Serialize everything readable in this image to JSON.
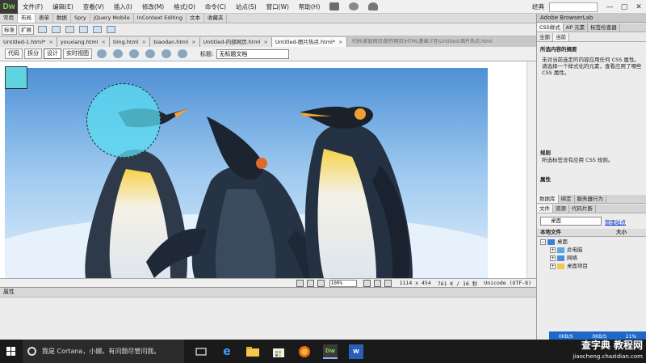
{
  "app": {
    "logo": "Dw",
    "menu": [
      "文件(F)",
      "编辑(E)",
      "查看(V)",
      "插入(I)",
      "修改(M)",
      "格式(O)",
      "命令(C)",
      "站点(S)",
      "窗口(W)",
      "帮助(H)"
    ],
    "workspace": "经典"
  },
  "insert_tabs": [
    "常用",
    "布局",
    "表单",
    "数据",
    "Spry",
    "jQuery Mobile",
    "InContext Editing",
    "文本",
    "收藏夹"
  ],
  "insert_tabs_active": 1,
  "insert_bar": {
    "standard": "标准",
    "expanded": "扩展"
  },
  "doc_tabs": [
    {
      "label": "Untitled-1.html*"
    },
    {
      "label": "youxiang.html"
    },
    {
      "label": "timg.html"
    },
    {
      "label": "biaodan.html"
    },
    {
      "label": "Untitled-内部网页.html"
    },
    {
      "label": "Untitled-图片热点.html*"
    }
  ],
  "doc_tabs_active": 5,
  "doc_path": "代码\\家庭网页\\制作网页\\HTML基础\\7月\\Untitled-图片热点.html",
  "doc_toolbar": {
    "views": [
      "代码",
      "拆分",
      "设计",
      "实时视图"
    ],
    "active_view": 2,
    "title_label": "标题:",
    "title_value": "无标题文档"
  },
  "status_bar": {
    "zoom": "100%",
    "dimensions": "1114 x 454",
    "size": "761 K / 16 秒",
    "encoding": "Unicode (UTF-8)"
  },
  "properties": {
    "header": "属性"
  },
  "right_panel": {
    "browserlab": "Adobe BrowserLab",
    "css_tabs": [
      "CSS样式",
      "AP 元素",
      "标签检查器"
    ],
    "css_subtabs": [
      "全部",
      "当前"
    ],
    "summary_title": "所选内容的摘要",
    "summary_text": "未对当前选定的内容应用任何 CSS 属性。请选择一个样式化的元素，查看应用了哪些 CSS 属性。",
    "rules_title": "规则",
    "rules_text": "所选标签没有应用 CSS 规则。",
    "props_title": "属性",
    "files_tabs": [
      "数据库",
      "绑定",
      "服务器行为"
    ],
    "files_subtabs": [
      "文件",
      "资源",
      "代码片断"
    ],
    "location": "桌面",
    "manage_sites": "管理站点",
    "local_files": "本地文件",
    "size_col": "大小",
    "tree": [
      "桌面",
      "此电脑",
      "网络",
      "桌面项目"
    ]
  },
  "speed": {
    "down": "0KB/S",
    "up": "0KB/S",
    "pct": "21%"
  },
  "taskbar": {
    "cortana": "我是 Cortana，小娜。有问题尽管问我。",
    "dw_label": "Dw",
    "word_label": "W"
  },
  "watermark": {
    "main": "查字典 教程网",
    "sub": "jiaocheng.chazidian.com"
  }
}
